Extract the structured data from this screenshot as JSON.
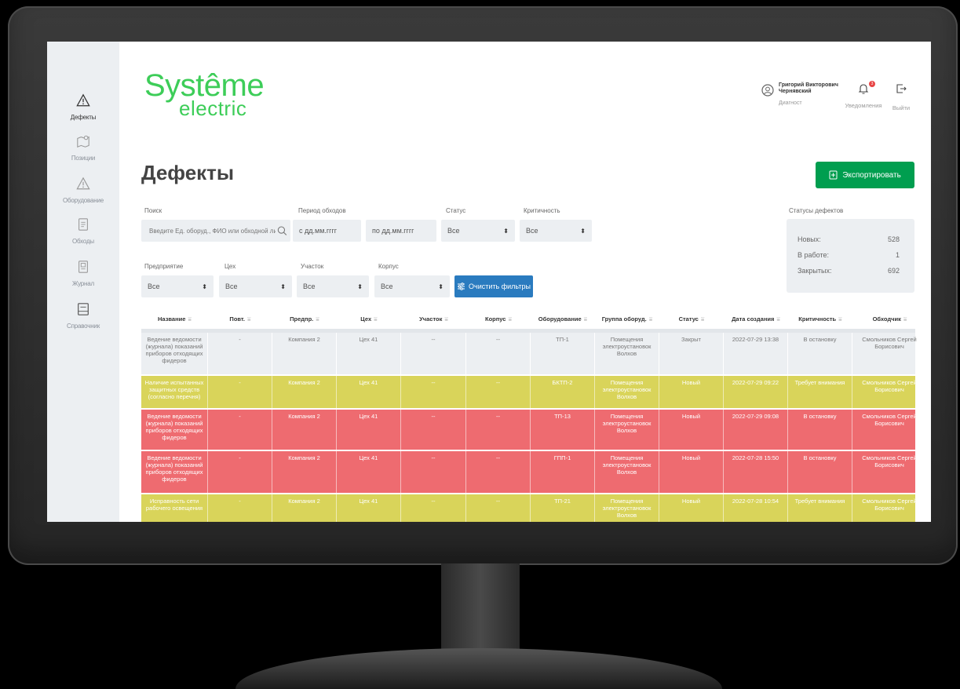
{
  "sidebar": {
    "items": [
      {
        "label": "Дефекты",
        "icon": "warning-icon"
      },
      {
        "label": "Позиции",
        "icon": "map-icon"
      },
      {
        "label": "Оборудование",
        "icon": "warning-icon"
      },
      {
        "label": "Обходы",
        "icon": "document-icon"
      },
      {
        "label": "Журнал",
        "icon": "journal-icon"
      },
      {
        "label": "Справочник",
        "icon": "reference-icon"
      }
    ]
  },
  "header": {
    "logo_line1": "Systême",
    "logo_line2": "electric",
    "user_name": "Григорий Викторович Чернявский",
    "user_role": "Диагност",
    "notifications_label": "Уведомления",
    "notifications_count": "3",
    "logout_label": "Выйти"
  },
  "page": {
    "title": "Дефекты",
    "export_label": "Экспортировать"
  },
  "filters": {
    "search_label": "Поиск",
    "search_placeholder": "Введите Ед. оборуд., ФИО или обходной лист",
    "period_label": "Период обходов",
    "period_from": "с  дд.мм.гггг",
    "period_to": "по  дд.мм.гггг",
    "status_label": "Статус",
    "status_value": "Все",
    "criticality_label": "Критичность",
    "criticality_value": "Все",
    "enterprise_label": "Предприятие",
    "enterprise_value": "Все",
    "shop_label": "Цех",
    "shop_value": "Все",
    "section_label": "Участок",
    "section_value": "Все",
    "building_label": "Корпус",
    "building_value": "Все",
    "clear_label": "Очистить фильтры"
  },
  "status_summary": {
    "title": "Статусы дефектов",
    "rows": [
      {
        "label": "Новых:",
        "value": "528"
      },
      {
        "label": "В работе:",
        "value": "1"
      },
      {
        "label": "Закрытых:",
        "value": "692"
      }
    ]
  },
  "table": {
    "columns": [
      "Название",
      "Повт.",
      "Предпр.",
      "Цех",
      "Участок",
      "Корпус",
      "Оборудование",
      "Группа оборуд.",
      "Статус",
      "Дата создания",
      "Критичность",
      "Обходчик"
    ],
    "rows": [
      {
        "kind": "closed",
        "cells": [
          "Ведение ведомости (журнала) показаний приборов отходящих фидеров",
          "-",
          "Компания 2",
          "Цех 41",
          "--",
          "--",
          "ТП-1",
          "Помещения электроустановок Волхов",
          "Закрыт",
          "2022-07-29 13:38",
          "В остановку",
          "Смольников Сергей Борисович"
        ]
      },
      {
        "kind": "warn",
        "cells": [
          "Наличие испытанных защитных средств (согласно перечня)",
          "-",
          "Компания 2",
          "Цех 41",
          "--",
          "--",
          "БКТП-2",
          "Помещения электроустановок Волхов",
          "Новый",
          "2022-07-29 09:22",
          "Требует внимания",
          "Смольников Сергей Борисович"
        ]
      },
      {
        "kind": "crit",
        "cells": [
          "Ведение ведомости (журнала) показаний приборов отходящих фидеров",
          "-",
          "Компания 2",
          "Цех 41",
          "--",
          "--",
          "ТП-13",
          "Помещения электроустановок Волхов",
          "Новый",
          "2022-07-29 09:08",
          "В остановку",
          "Смольников Сергей Борисович"
        ]
      },
      {
        "kind": "crit",
        "cells": [
          "Ведение ведомости (журнала) показаний приборов отходящих фидеров",
          "-",
          "Компания 2",
          "Цех 41",
          "--",
          "--",
          "ГПП-1",
          "Помещения электроустановок Волхов",
          "Новый",
          "2022-07-28 15:50",
          "В остановку",
          "Смольников Сергей Борисович"
        ]
      },
      {
        "kind": "warn",
        "cells": [
          "Исправность сети рабочего освещения",
          "-",
          "Компания 2",
          "Цех 41",
          "--",
          "--",
          "ТП-21",
          "Помещения электроустановок Волхов",
          "Новый",
          "2022-07-28 10:54",
          "Требует внимания",
          "Смольников Сергей Борисович"
        ]
      }
    ]
  },
  "colors": {
    "brand_green": "#3dcd58",
    "export_green": "#009e4f",
    "clear_blue": "#2a7bbf",
    "row_warn": "#d9d45a",
    "row_critical": "#ee6b70",
    "row_closed": "#eceff2"
  }
}
